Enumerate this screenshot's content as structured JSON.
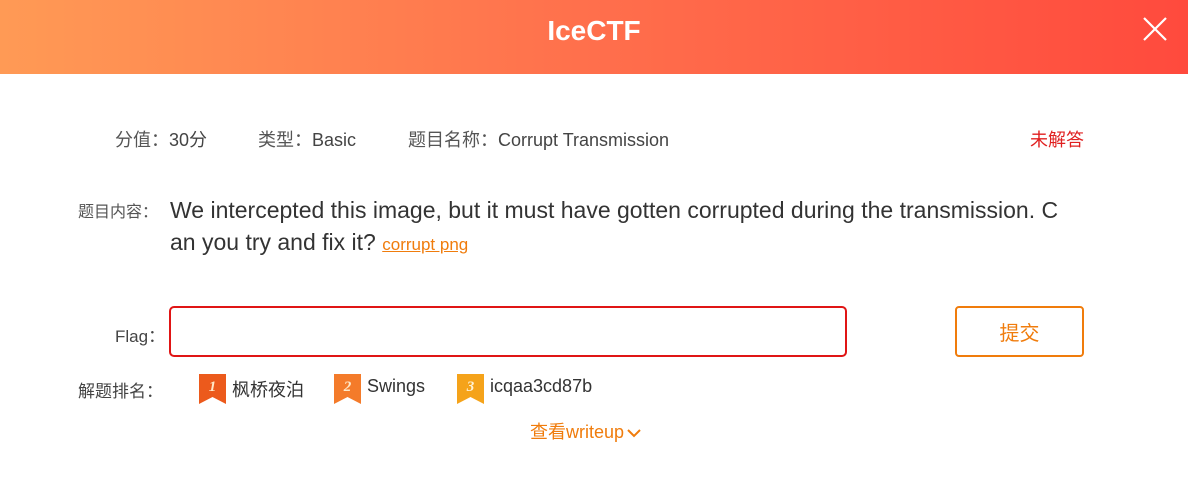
{
  "header": {
    "title": "IceCTF"
  },
  "meta": {
    "score_label": "分值：",
    "score_value": "30分",
    "type_label": "类型：",
    "type_value": "Basic",
    "name_label": "题目名称：",
    "name_value": "Corrupt Transmission",
    "status": "未解答"
  },
  "content": {
    "label": "题目内容：",
    "text": "We intercepted this image, but it must have gotten corrupted during the transmission. Can you try and fix it? ",
    "link_text": "corrupt png"
  },
  "flag": {
    "label": "Flag：",
    "value": "",
    "placeholder": "",
    "submit_label": "提交"
  },
  "ranking": {
    "label": "解题排名：",
    "items": [
      {
        "rank": "1",
        "name": "枫桥夜泊",
        "badge_color": "#ec5a1c"
      },
      {
        "rank": "2",
        "name": "Swings",
        "badge_color": "#f47b2a"
      },
      {
        "rank": "3",
        "name": "icqaa3cd87b",
        "badge_color": "#f5a31a"
      }
    ]
  },
  "writeup": {
    "label": "查看writeup"
  },
  "colors": {
    "accent": "#f07c0c",
    "error": "#e01515",
    "header_start": "#ff9a55",
    "header_end": "#ff4a3d"
  }
}
